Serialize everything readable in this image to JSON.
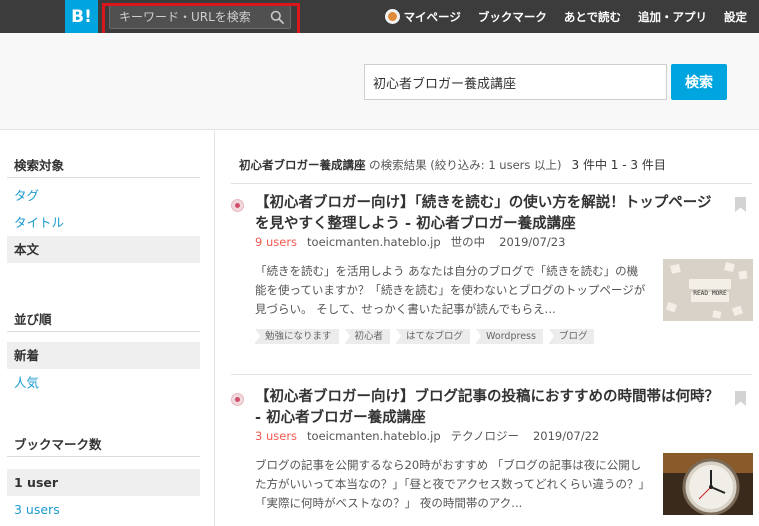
{
  "header": {
    "logo": "B!",
    "search_placeholder": "キーワード・URLを検索",
    "nav": {
      "mypage": "マイページ",
      "bookmark": "ブックマーク",
      "later": "あとで読む",
      "add_app": "追加・アプリ",
      "settings": "設定"
    }
  },
  "search": {
    "query": "初心者ブロガー養成講座",
    "button": "検索"
  },
  "sidebar": {
    "target": {
      "title": "検索対象",
      "items": [
        "タグ",
        "タイトル",
        "本文"
      ],
      "active_index": 2
    },
    "sort": {
      "title": "並び順",
      "items": [
        "新着",
        "人気"
      ],
      "active_index": 0
    },
    "bookmarks": {
      "title": "ブックマーク数",
      "items": [
        "1 user",
        "3 users"
      ],
      "active_index": 0
    }
  },
  "results": {
    "keyword": "初心者ブロガー養成講座",
    "suffix": " の検索結果 (絞り込み: 1 users 以上)",
    "count": "3 件中 1 - 3 件目",
    "entries": [
      {
        "title": "【初心者ブロガー向け】「続きを読む」の使い方を解説！トップページを見やすく整理しよう - 初心者ブロガー養成講座",
        "users": "9 users",
        "domain": "toeicmanten.hateblo.jp",
        "category": "世の中",
        "date": "2019/07/23",
        "description": "「続きを読む」を活用しよう あなたは自分のブログで「続きを読む」の機能を使っていますか？「続きを読む」を使わないとブログのトップページが見づらい。 そして、せっかく書いた記事が読んでもらえ...",
        "tags": [
          "勉強になります",
          "初心者",
          "はてなブログ",
          "Wordpress",
          "ブログ"
        ],
        "thumb_text": "READ MORE"
      },
      {
        "title": "【初心者ブロガー向け】ブログ記事の投稿におすすめの時間帯は何時？ - 初心者ブロガー養成講座",
        "users": "3 users",
        "domain": "toeicmanten.hateblo.jp",
        "category": "テクノロジー",
        "date": "2019/07/22",
        "description": "ブログの記事を公開するなら20時がおすすめ 「ブログの記事は夜に公開した方がいいって本当なの？」「昼と夜でアクセス数ってどれくらい違うの？」「実際に何時がベストなの？」 夜の時間帯のアク..."
      }
    ]
  }
}
